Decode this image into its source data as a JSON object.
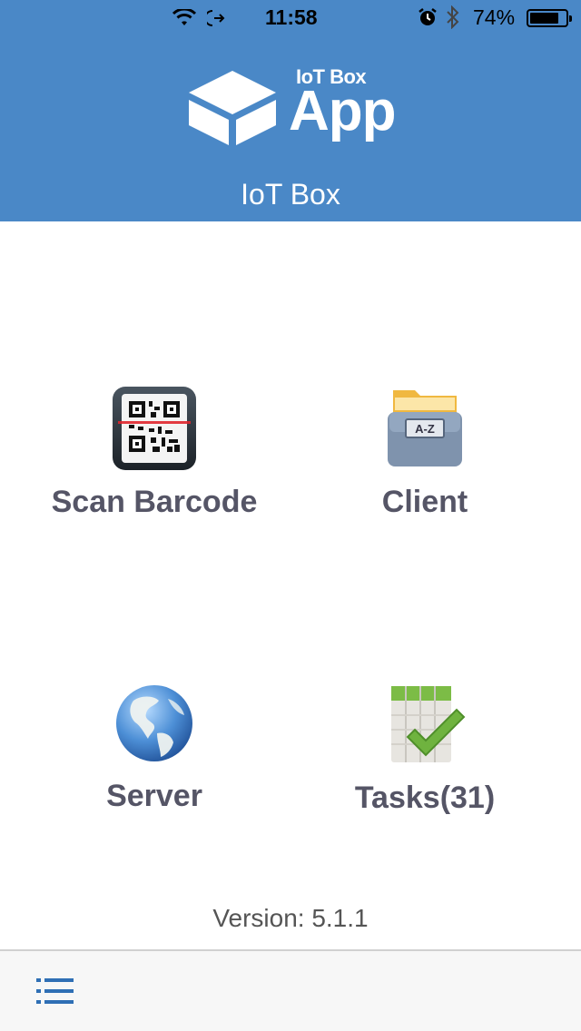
{
  "status_bar": {
    "time": "11:58",
    "battery": "74%",
    "icons": [
      "wifi-icon",
      "location-arrow-icon",
      "alarm-icon",
      "bluetooth-icon",
      "battery-icon"
    ]
  },
  "header": {
    "logo_small": "IoT Box",
    "logo_big": "App",
    "title": "IoT Box",
    "background": "#4a88c7"
  },
  "tiles": [
    {
      "label": "Scan Barcode",
      "icon": "qr-scanner-icon"
    },
    {
      "label": "Client",
      "icon": "file-cabinet-icon"
    },
    {
      "label": "Server",
      "icon": "globe-icon"
    },
    {
      "label": "Tasks(31)",
      "icon": "task-checklist-icon"
    }
  ],
  "footer": {
    "version": "Version: 5.1.1",
    "menu_icon": "list-menu-icon"
  },
  "client_icon_text": "A-Z"
}
